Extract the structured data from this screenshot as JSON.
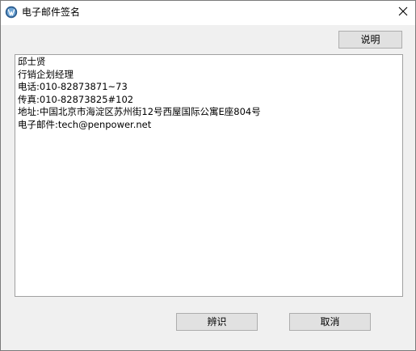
{
  "window": {
    "title": "电子邮件签名",
    "icon": "app-globe-icon",
    "close_icon": "close-icon"
  },
  "toolbar": {
    "help_label": "说明"
  },
  "signature": {
    "lines": [
      "邱士贤",
      "行销企划经理",
      "电话:010-82873871~73",
      "传真:010-82873825#102",
      "地址:中国北京市海淀区苏州街12号西屋国际公寓E座804号",
      "电子邮件:tech@penpower.net"
    ]
  },
  "footer": {
    "ok_label": "辨识",
    "cancel_label": "取消"
  },
  "colors": {
    "window_bg": "#f0f0f0",
    "button_bg": "#e1e1e1",
    "button_border": "#adadad",
    "textarea_border": "#a0a0a0"
  }
}
